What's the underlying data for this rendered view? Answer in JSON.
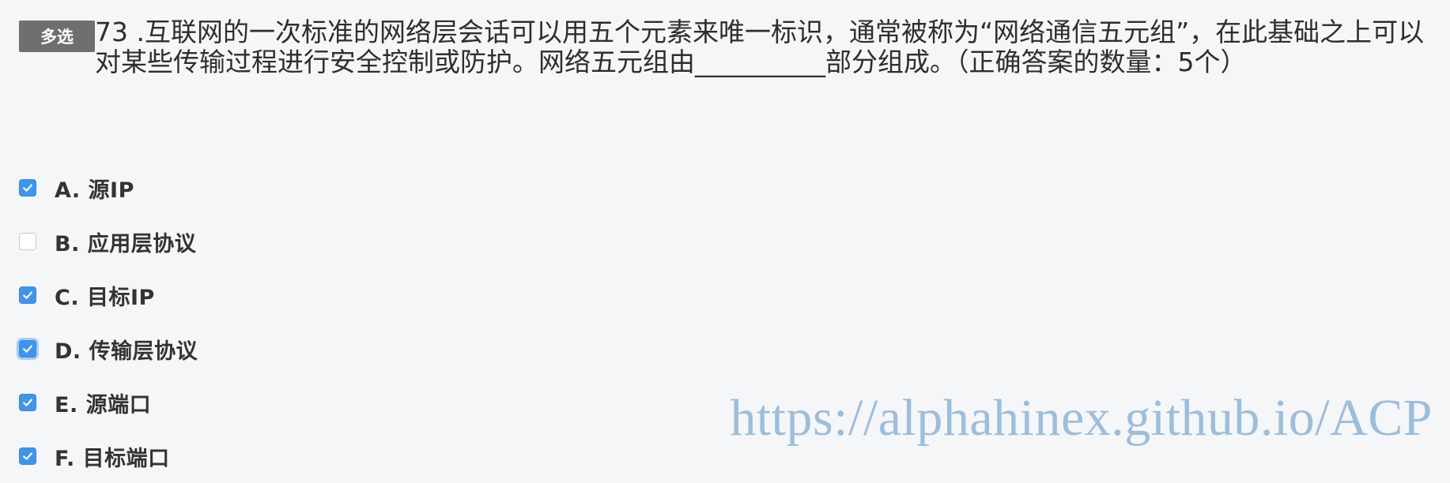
{
  "question": {
    "type_tag": "多选",
    "stem": "73 .互联网的一次标准的网络层会话可以用五个元素来唯一标识，通常被称为“网络通信五元组”，在此基础之上可以对某些传输过程进行安全控制或防护。网络五元组由__________部分组成。（正确答案的数量：5个）"
  },
  "options": [
    {
      "label": "A. 源IP",
      "checked": true,
      "focused": false
    },
    {
      "label": "B. 应用层协议",
      "checked": false,
      "focused": false
    },
    {
      "label": "C. 目标IP",
      "checked": true,
      "focused": false
    },
    {
      "label": "D. 传输层协议",
      "checked": true,
      "focused": true
    },
    {
      "label": "E. 源端口",
      "checked": true,
      "focused": false
    },
    {
      "label": "F. 目标端口",
      "checked": true,
      "focused": false
    }
  ],
  "watermark": "https://alphahinex.github.io/ACP",
  "colors": {
    "checkbox_checked": "#3f94ee",
    "tag_background": "#6f6f6f",
    "watermark": "#9cbedd"
  },
  "icons": {
    "checked": "check-icon"
  }
}
